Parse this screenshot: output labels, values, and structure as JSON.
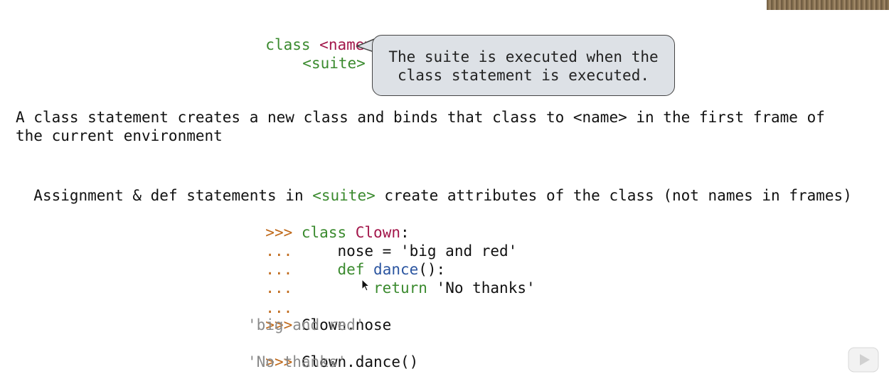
{
  "syntax": {
    "line1_keyword": "class",
    "line1_name": "<name>",
    "line1_colon": ":",
    "line2_suite": "<suite>"
  },
  "callout": {
    "line1": "The suite is executed when the",
    "line2": "class statement is executed."
  },
  "paragraph1": {
    "line1": "A class statement creates a new class and binds that class to <name> in the first frame of",
    "line2": "the current environment"
  },
  "paragraph2": {
    "before": "Assignment & def statements in ",
    "highlight": "<suite>",
    "after": " create attributes of the class (not names in frames)"
  },
  "code": {
    "prompt": ">>>",
    "continuation": "...",
    "l1_keyword": "class",
    "l1_name": "Clown",
    "l1_colon": ":",
    "l2_text": "nose = 'big and red'",
    "l3_keyword": "def",
    "l3_name": "dance",
    "l3_rest": "():",
    "l4_keyword": "return",
    "l4_string": "'No thanks'",
    "l6_expr": "Clown.nose",
    "l7_output": "'big and red'",
    "l8_expr": "Clown.dance()",
    "l9_output": "'No thanks'"
  },
  "icons": {
    "cursor": "mouse-pointer-icon",
    "play": "play-icon",
    "thumbnail": "video-thumbnail"
  },
  "colors": {
    "keyword_green": "#3a8a2e",
    "name_maroon": "#a3174b",
    "func_blue": "#2b55a0",
    "prompt_orange": "#c06a1b",
    "output_gray": "#8a8a8a",
    "callout_bg": "#dde1e6"
  }
}
